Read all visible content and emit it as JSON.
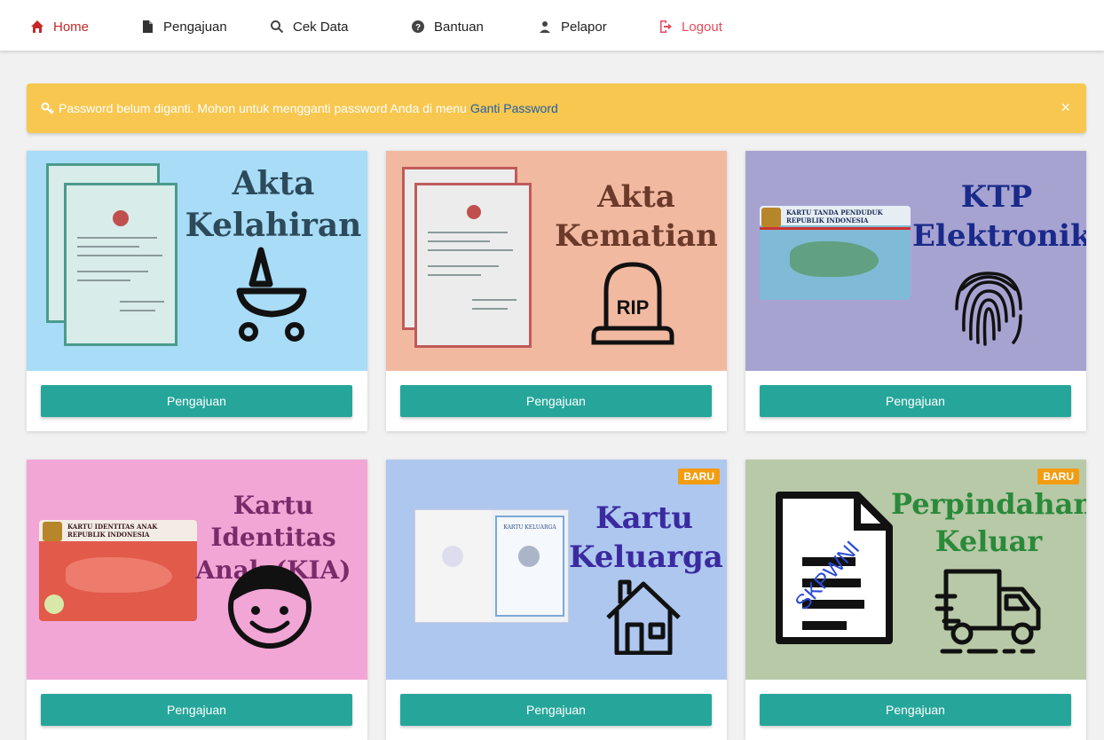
{
  "nav": {
    "items": [
      {
        "label": "Home",
        "icon": "home-icon",
        "active": true
      },
      {
        "label": "Pengajuan",
        "icon": "document-icon"
      },
      {
        "label": "Cek Data",
        "icon": "search-icon"
      },
      {
        "label": "Bantuan",
        "icon": "help-icon"
      },
      {
        "label": "Pelapor",
        "icon": "user-icon"
      },
      {
        "label": "Logout",
        "icon": "logout-icon",
        "color": "#e84a5f"
      }
    ],
    "active_color": "#c62828"
  },
  "alert": {
    "icon": "key-icon",
    "message": "Password belum diganti. Mohon untuk mengganti password Anda di menu",
    "link": "Ganti Password",
    "close": "×",
    "color": "#f7c74f"
  },
  "cards": [
    {
      "title_line1": "Akta",
      "title_line2": "Kelahiran",
      "icon": "stroller-icon",
      "bg": "#a8dcf7",
      "button": "Pengajuan"
    },
    {
      "title_line1": "Akta",
      "title_line2": "Kematian",
      "icon": "tombstone-icon",
      "tomb_text": "RIP",
      "bg": "#f2b9a1",
      "button": "Pengajuan"
    },
    {
      "title_line1": "KTP",
      "title_line2": "Elektronik",
      "icon": "fingerprint-icon",
      "card_text1": "KARTU TANDA PENDUDUK",
      "card_text2": "REPUBLIK INDONESIA",
      "bg": "#a7a3d1",
      "button": "Pengajuan"
    },
    {
      "title_line1": "Kartu Identitas",
      "title_line2": "Anak (KIA)",
      "icon": "child-face-icon",
      "card_text1": "KARTU IDENTITAS ANAK",
      "card_text2": "REPUBLIK INDONESIA",
      "bg": "#f2a6d6",
      "button": "Pengajuan"
    },
    {
      "title_line1": "Kartu",
      "title_line2": "Keluarga",
      "icon": "house-icon",
      "card_text1": "KARTU KELUARGA",
      "badge": "BARU",
      "bg": "#aec7ef",
      "button": "Pengajuan"
    },
    {
      "title_line1": "Perpindahan",
      "title_line2": "Keluar",
      "icon": "truck-icon",
      "doc_stamp": "SKPWNI",
      "badge": "BARU",
      "bg": "#b8c9a7",
      "button": "Pengajuan"
    }
  ],
  "title_colors": {
    "teal": "#2c4a5a",
    "brown": "#6b3a2a",
    "navy": "#1a2a8a",
    "purple": "#7a2a6a",
    "indigo": "#3a2aa0",
    "green": "#2a8a3a"
  },
  "button_color": "#26a69a"
}
